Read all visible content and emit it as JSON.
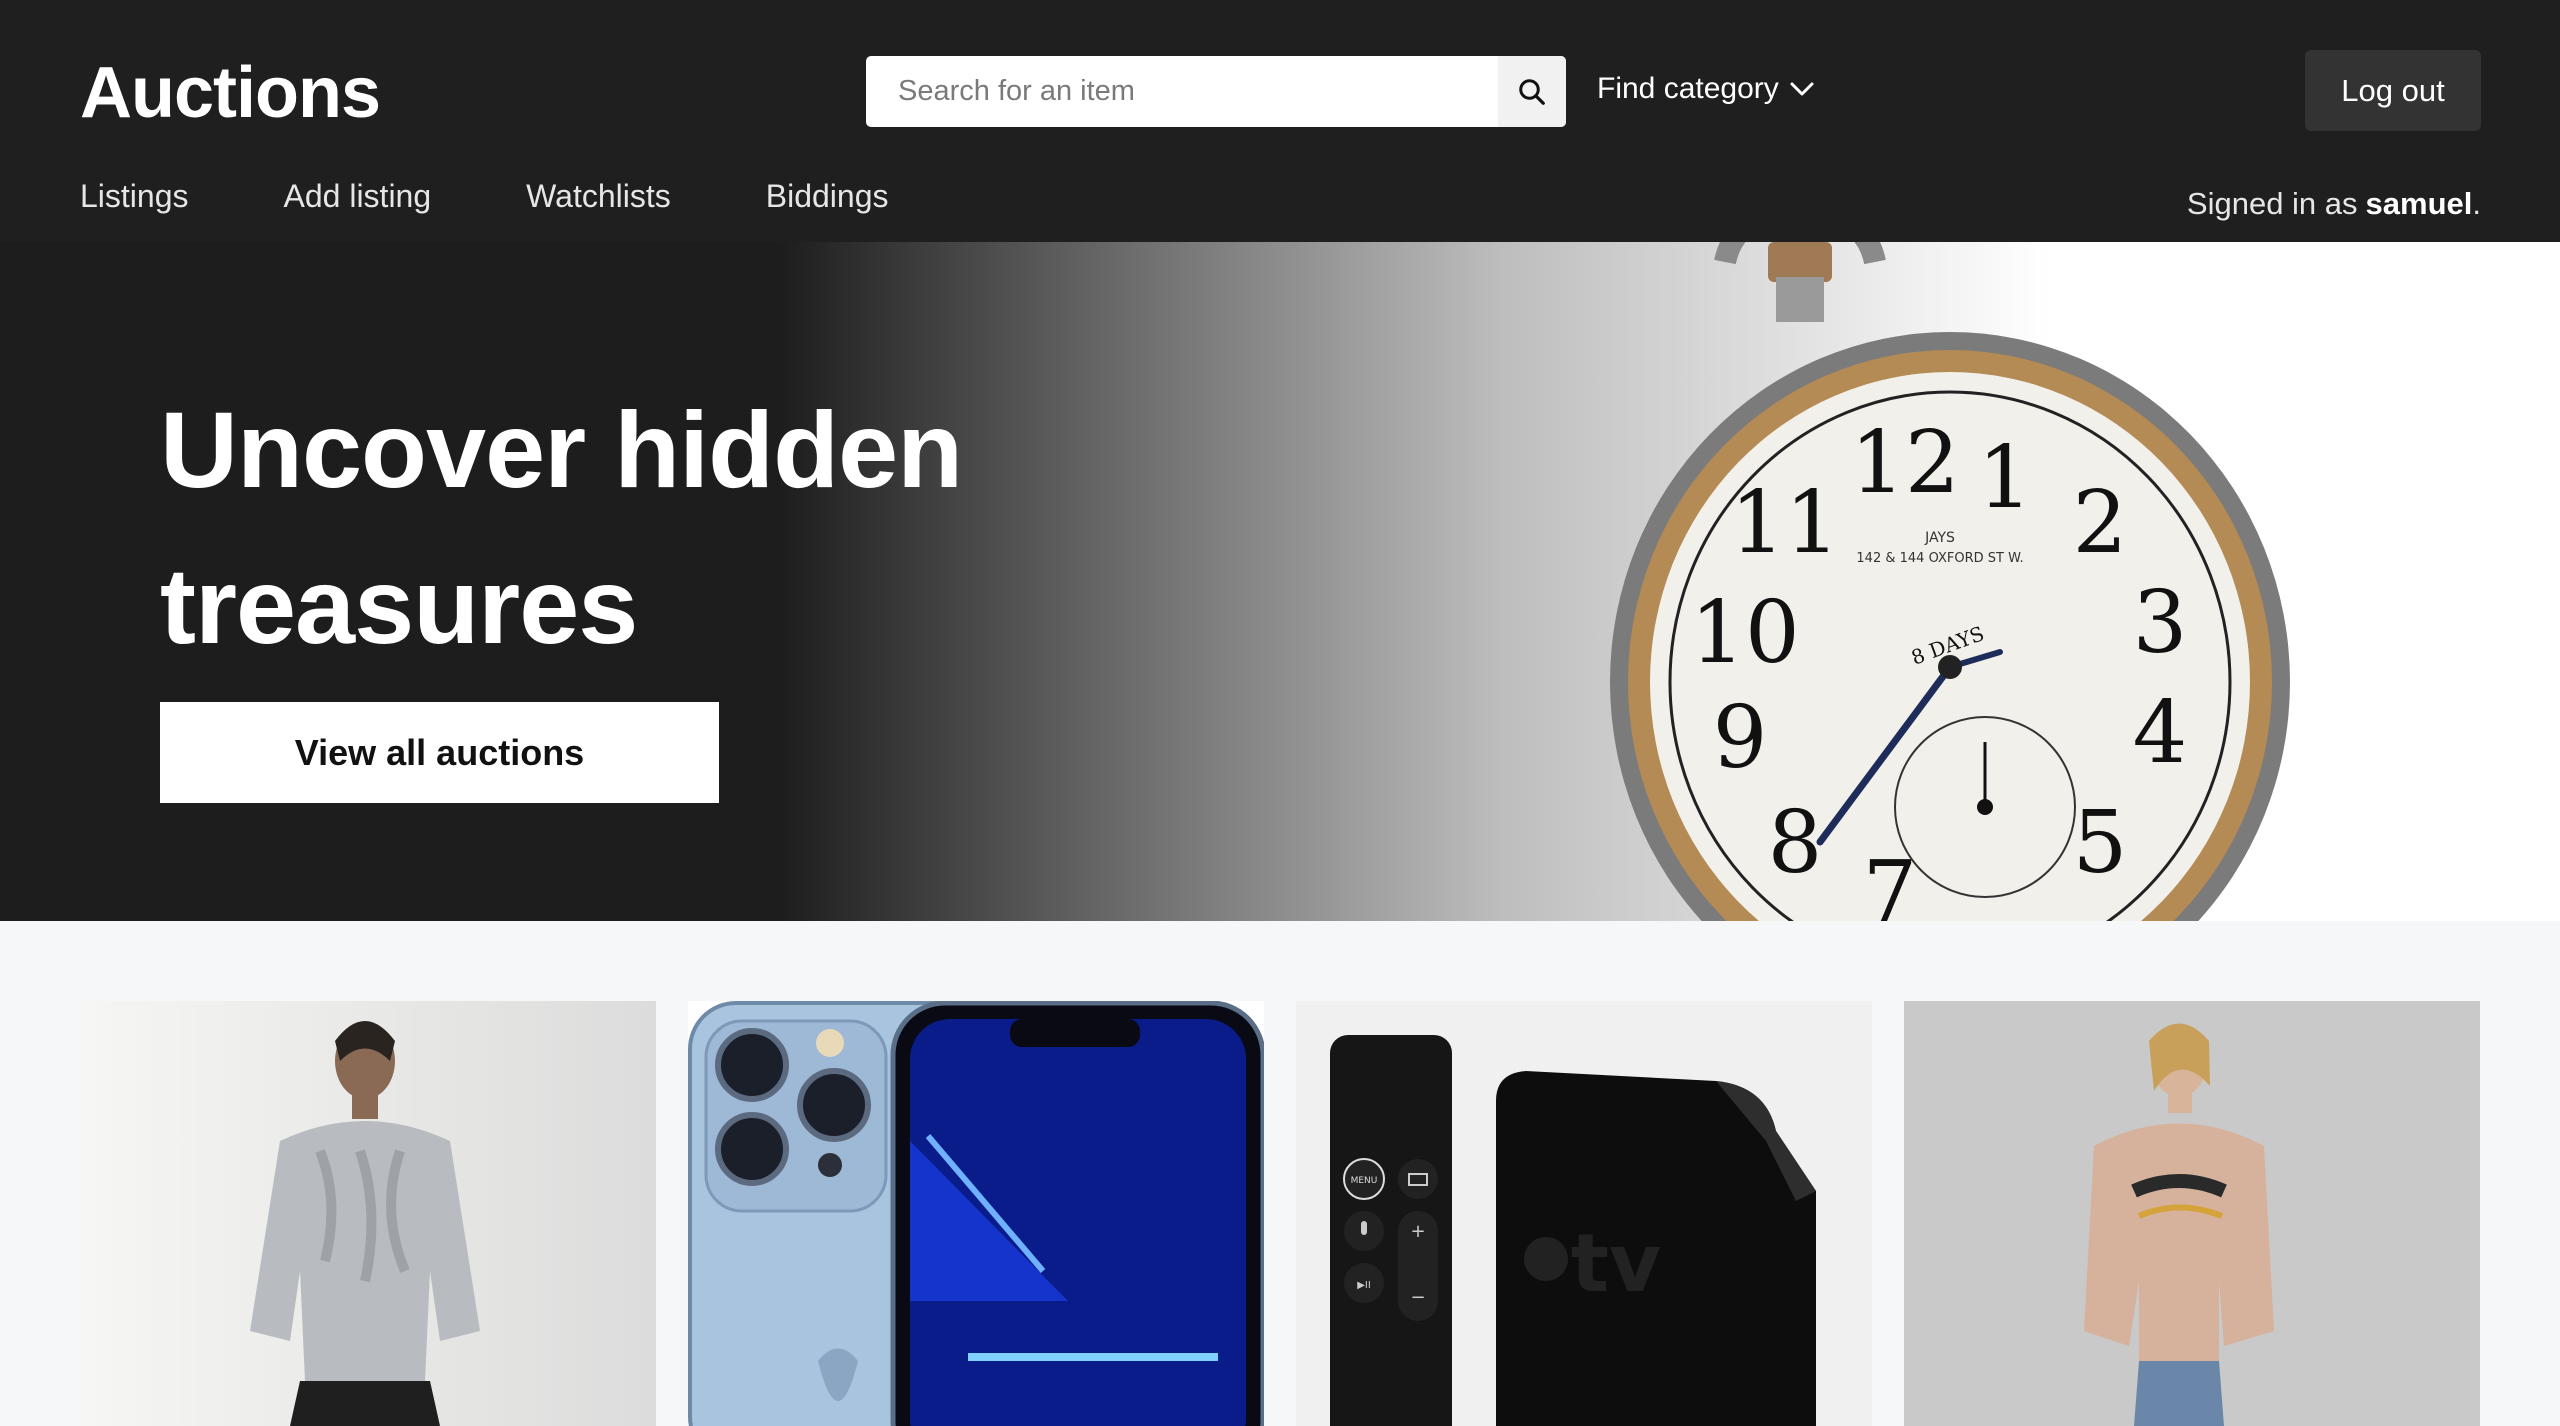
{
  "header": {
    "brand": "Auctions",
    "search": {
      "placeholder": "Search for an item",
      "icon": "search-icon"
    },
    "category_label": "Find category",
    "logout_label": "Log out",
    "nav": [
      "Listings",
      "Add listing",
      "Watchlists",
      "Biddings"
    ],
    "signed_in_prefix": "Signed in as",
    "username": "samuel",
    "signed_in_suffix": "."
  },
  "hero": {
    "title_line1": "Uncover hidden",
    "title_line2": "treasures",
    "cta_label": "View all auctions"
  },
  "colors": {
    "header_bg": "#1f1f1f",
    "logout_bg": "#333333",
    "page_bg": "#f6f7f9"
  },
  "cards": [
    {
      "image": "woman in grey ruffled knit jumper"
    },
    {
      "image": "blue smartphone with triple camera"
    },
    {
      "image": "black streaming box with remote"
    },
    {
      "image": "woman in pink hooded sweatshirt"
    }
  ]
}
